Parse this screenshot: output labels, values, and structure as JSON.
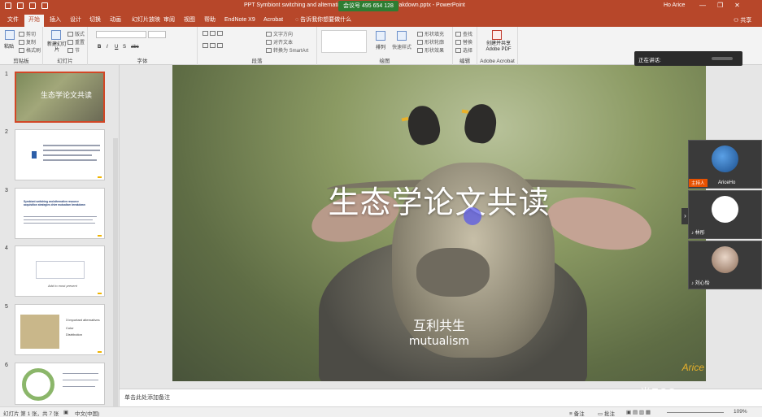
{
  "titlebar": {
    "title": "PPT Symbiont switching and alternative reso... mutualism breakdown.pptx - PowerPoint",
    "meeting": "会议号 495 654 128",
    "user": "Ho Arice",
    "min": "—",
    "max": "❐",
    "close": "✕"
  },
  "tabs": [
    "文件",
    "开始",
    "插入",
    "设计",
    "切换",
    "动画",
    "幻灯片放映",
    "审阅",
    "视图",
    "帮助",
    "EndNote X9",
    "Acrobat",
    "告诉我你想要做什么"
  ],
  "share": "共享",
  "ribbon": {
    "clipboard": {
      "label": "剪贴板",
      "paste": "粘贴",
      "cut": "剪切",
      "copy": "复制",
      "format": "格式刷"
    },
    "slides": {
      "label": "幻灯片",
      "new": "新建幻灯片",
      "layout": "版式",
      "reset": "重置",
      "section": "节"
    },
    "font": {
      "label": "字体",
      "bold": "B",
      "italic": "I",
      "underline": "U",
      "strike": "S",
      "shadow": "abc"
    },
    "paragraph": {
      "label": "段落",
      "direction": "文字方向",
      "align": "对齐文本",
      "smartart": "转换为 SmartArt"
    },
    "drawing": {
      "label": "绘图",
      "arrange": "排列",
      "quickstyles": "快速样式",
      "fill": "形状填充",
      "outline": "形状轮廓",
      "effect": "形状效果"
    },
    "editing": {
      "label": "编辑",
      "find": "查找",
      "replace": "替换",
      "select": "选择"
    },
    "acrobat": {
      "label": "Adobe Acrobat",
      "create": "创建并共享 Adobe PDF"
    }
  },
  "thumbnails": [
    {
      "num": "1",
      "title": "生态学论文共读"
    },
    {
      "num": "2"
    },
    {
      "num": "3",
      "title": "Symbiont switching and alternative resource acquisition strategies drive mutualism breakdown"
    },
    {
      "num": "4",
      "caption": "Add to most present"
    },
    {
      "num": "5",
      "lines": [
        "3 important alternatives",
        "Color",
        "Distribution"
      ]
    },
    {
      "num": "6"
    }
  ],
  "slide": {
    "title": "生态学论文共读",
    "subtitle_cn": "互利共生",
    "subtitle_en": "mutualism",
    "signature": "Arice"
  },
  "notes_placeholder": "单击此处添加备注",
  "status": {
    "slide_count": "幻灯片 第 1 张，共 7 张",
    "language": "中文(中国)",
    "notes": "备注",
    "comments": "批注",
    "zoom": "109%"
  },
  "meeting_panel": {
    "speaking": "正在讲话:",
    "participants": [
      {
        "name": "AriceHo",
        "host": "主持人"
      },
      {
        "name": "林彤"
      },
      {
        "name": "刘心怡"
      }
    ]
  },
  "watermark": "一米ECO"
}
